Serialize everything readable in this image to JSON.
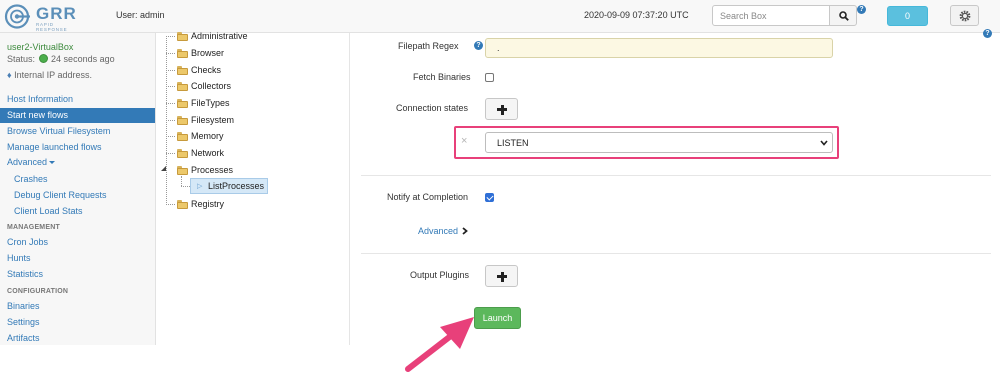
{
  "header": {
    "logo": {
      "title": "GRR",
      "subtitle": "RAPID RESPONSE"
    },
    "user_label": "User: admin",
    "timestamp": "2020-09-09 07:37:20 UTC",
    "search": {
      "placeholder": "Search Box",
      "value": ""
    },
    "notification_count": "0",
    "icons": [
      "search-icon",
      "help-icon",
      "gear-icon"
    ]
  },
  "client": {
    "name": "user2-VirtualBox",
    "status_prefix": "Status:",
    "status_value": "24 seconds ago",
    "ip_text": "Internal IP address.",
    "status_color": "#4cae4c"
  },
  "nav": {
    "items": [
      {
        "label": "Host Information",
        "active": false
      },
      {
        "label": "Start new flows",
        "active": true
      },
      {
        "label": "Browse Virtual Filesystem",
        "active": false
      },
      {
        "label": "Manage launched flows",
        "active": false
      },
      {
        "label": "Advanced",
        "active": false
      }
    ],
    "advanced_items": [
      "Crashes",
      "Debug Client Requests",
      "Client Load Stats"
    ],
    "management_heading": "MANAGEMENT",
    "management_items": [
      "Cron Jobs",
      "Hunts",
      "Statistics"
    ],
    "configuration_heading": "CONFIGURATION",
    "configuration_items": [
      "Binaries",
      "Settings",
      "Artifacts"
    ]
  },
  "tree": {
    "categories": [
      "Administrative",
      "Browser",
      "Checks",
      "Collectors",
      "FileTypes",
      "Filesystem",
      "Memory",
      "Network",
      "Processes",
      "Registry"
    ],
    "selected_flow": "ListProcesses"
  },
  "form": {
    "filepath_regex_label": "Filepath Regex",
    "filepath_regex_value": ".",
    "fetch_binaries_label": "Fetch Binaries",
    "fetch_binaries_checked": false,
    "connection_states_label": "Connection states",
    "connection_state_value": "LISTEN",
    "remove_symbol": "×",
    "notify_label": "Notify at Completion",
    "notify_checked": true,
    "advanced_label": "Advanced",
    "output_plugins_label": "Output Plugins",
    "launch_label": "Launch"
  },
  "colors": {
    "accent": "#337ab7",
    "launch": "#5cb85c",
    "highlight": "#e8407a",
    "regex_bg": "#fcf8e3",
    "notification": "#5bc0de"
  }
}
